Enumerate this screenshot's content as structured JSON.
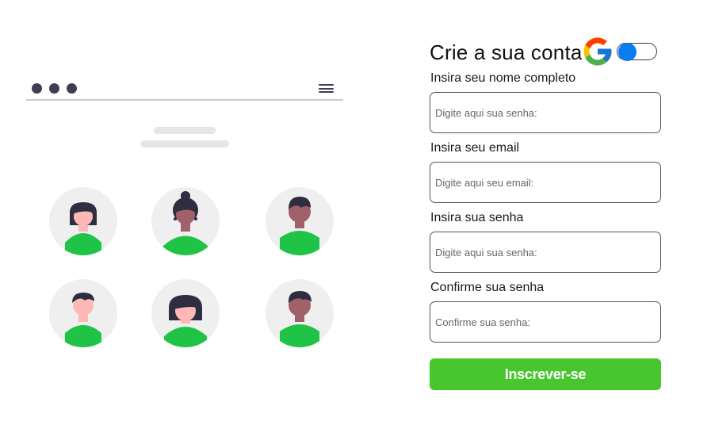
{
  "form": {
    "title": "Crie a sua conta",
    "fields": [
      {
        "label": "Insira seu nome completo",
        "placeholder": "Digite aqui sua senha:"
      },
      {
        "label": "Insira seu email",
        "placeholder": "Digite aqui seu email:"
      },
      {
        "label": "Insira sua senha",
        "placeholder": "Digite aqui sua senha:"
      },
      {
        "label": "Confirme sua senha",
        "placeholder": "Confirme sua senha:"
      }
    ],
    "submit_label": "Inscrever-se"
  },
  "toggle": {
    "state": "on",
    "accent_color": "#0a7cf0"
  },
  "icons": {
    "google": "google-logo-icon",
    "menu": "hamburger-menu-icon"
  },
  "colors": {
    "button": "#48c62e",
    "illustration_green": "#1fc447",
    "illustration_dark": "#3f3d56"
  }
}
